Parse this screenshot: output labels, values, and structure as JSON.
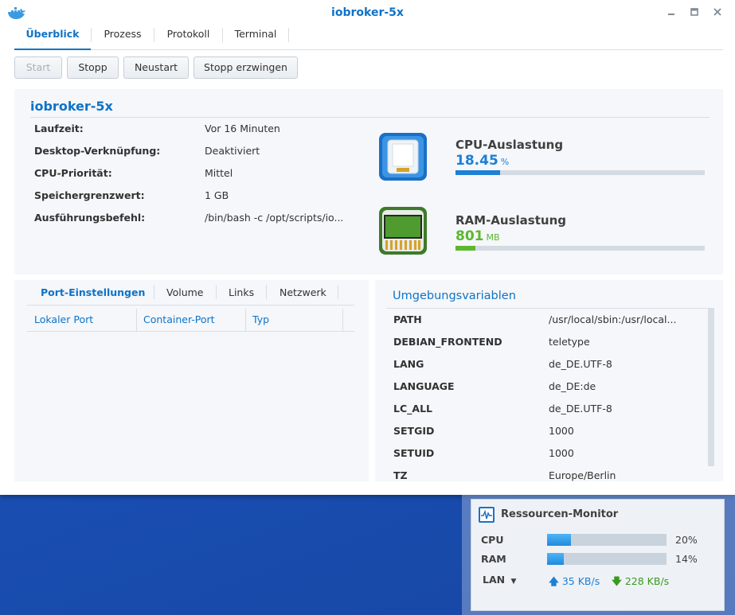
{
  "window": {
    "title": "iobroker-5x",
    "tabs": [
      "Überblick",
      "Prozess",
      "Protokoll",
      "Terminal"
    ],
    "active_tab": "Überblick"
  },
  "toolbar": {
    "start": "Start",
    "stop": "Stopp",
    "restart": "Neustart",
    "force_stop": "Stopp erzwingen"
  },
  "overview": {
    "title": "iobroker-5x",
    "props": [
      {
        "label": "Laufzeit:",
        "value": "Vor 16 Minuten"
      },
      {
        "label": "Desktop-Verknüpfung:",
        "value": "Deaktiviert"
      },
      {
        "label": "CPU-Priorität:",
        "value": "Mittel"
      },
      {
        "label": "Speichergrenzwert:",
        "value": "1 GB"
      },
      {
        "label": "Ausführungsbefehl:",
        "value": "/bin/bash -c /opt/scripts/io..."
      }
    ],
    "cpu": {
      "title": "CPU-Auslastung",
      "value": "18.45",
      "unit": "%",
      "fraction": 0.18,
      "color": "#1d7fd6"
    },
    "ram": {
      "title": "RAM-Auslastung",
      "value": "801",
      "unit": "MB",
      "fraction": 0.08,
      "color": "#5cb82e"
    }
  },
  "ports": {
    "tabs": [
      "Port-Einstellungen",
      "Volume",
      "Links",
      "Netzwerk"
    ],
    "columns": [
      "Lokaler Port",
      "Container-Port",
      "Typ"
    ]
  },
  "env": {
    "title": "Umgebungsvariablen",
    "rows": [
      {
        "key": "PATH",
        "value": "/usr/local/sbin:/usr/local..."
      },
      {
        "key": "DEBIAN_FRONTEND",
        "value": "teletype"
      },
      {
        "key": "LANG",
        "value": "de_DE.UTF-8"
      },
      {
        "key": "LANGUAGE",
        "value": "de_DE:de"
      },
      {
        "key": "LC_ALL",
        "value": "de_DE.UTF-8"
      },
      {
        "key": "SETGID",
        "value": "1000"
      },
      {
        "key": "SETUID",
        "value": "1000"
      },
      {
        "key": "TZ",
        "value": "Europe/Berlin"
      }
    ]
  },
  "monitor": {
    "title": "Ressourcen-Monitor",
    "cpu": {
      "label": "CPU",
      "pct": "20%",
      "fraction": 0.2
    },
    "ram": {
      "label": "RAM",
      "pct": "14%",
      "fraction": 0.14
    },
    "lan": {
      "label": "LAN",
      "up": "35 KB/s",
      "down": "228 KB/s",
      "up_color": "#1d7fd6",
      "down_color": "#3a9a1e"
    }
  }
}
